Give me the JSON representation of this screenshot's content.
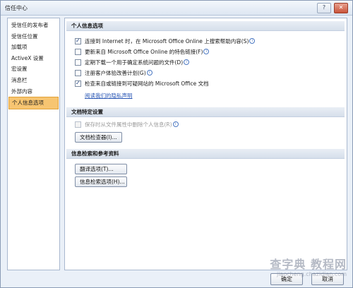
{
  "window": {
    "title": "信任中心",
    "help_glyph": "?",
    "close_glyph": "✕"
  },
  "sidebar": {
    "items": [
      {
        "label": "受信任的发布者",
        "active": false
      },
      {
        "label": "受信任位置",
        "active": false
      },
      {
        "label": "加载项",
        "active": false
      },
      {
        "label": "ActiveX 设置",
        "active": false
      },
      {
        "label": "宏设置",
        "active": false
      },
      {
        "label": "消息栏",
        "active": false
      },
      {
        "label": "外部内容",
        "active": false
      },
      {
        "label": "个人信息选项",
        "active": true
      }
    ]
  },
  "sections": {
    "personal": {
      "title": "个人信息选项",
      "options": [
        {
          "label": "连接到 Internet 时，在 Microsoft Office Online 上搜索帮助内容(S)",
          "checked": true
        },
        {
          "label": "更新来自 Microsoft Office Online 的特色链接(F)",
          "checked": false
        },
        {
          "label": "定期下载一个用于确定系统问题的文件(D)",
          "checked": false
        },
        {
          "label": "注册客户体验改善计划(G)",
          "checked": false
        },
        {
          "label": "检查来自或链接到可疑网站的 Microsoft Office 文档",
          "checked": true
        }
      ],
      "privacy_link": "阅读我们的隐私声明"
    },
    "document": {
      "title": "文档特定设置",
      "option": {
        "label": "保存时从文件属性中删除个人信息(R)",
        "checked": false,
        "disabled": true
      },
      "inspector_button": "文档检查器(I)..."
    },
    "research": {
      "title": "信息检索和参考资料",
      "translate_button": "翻译选项(T)...",
      "research_button": "信息检索选项(H)..."
    }
  },
  "footer": {
    "ok": "确定",
    "cancel": "取消"
  },
  "watermark": {
    "line1": "查字典 教程网",
    "line2": "jiaocheng.chazidian.com"
  }
}
